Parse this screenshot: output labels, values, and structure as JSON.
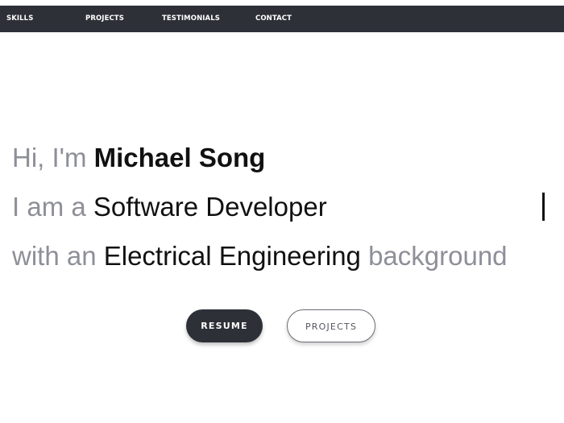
{
  "nav": {
    "items": [
      {
        "label": "SKILLS"
      },
      {
        "label": "PROJECTS"
      },
      {
        "label": "TESTIMONIALS"
      },
      {
        "label": "CONTACT"
      }
    ]
  },
  "hero": {
    "line1": {
      "prefix": "Hi, I'm ",
      "name": "Michael Song"
    },
    "line2": {
      "prefix": "I am a ",
      "role": "Software Developer"
    },
    "line3": {
      "prefix": "with an ",
      "field": "Electrical Engineering",
      "suffix": " background"
    },
    "buttons": {
      "resume": "RESUME",
      "projects": "PROJECTS"
    }
  },
  "colors": {
    "navbar_bg": "#2e3038",
    "muted_text": "#8e8f98",
    "dark_text": "#111111"
  }
}
